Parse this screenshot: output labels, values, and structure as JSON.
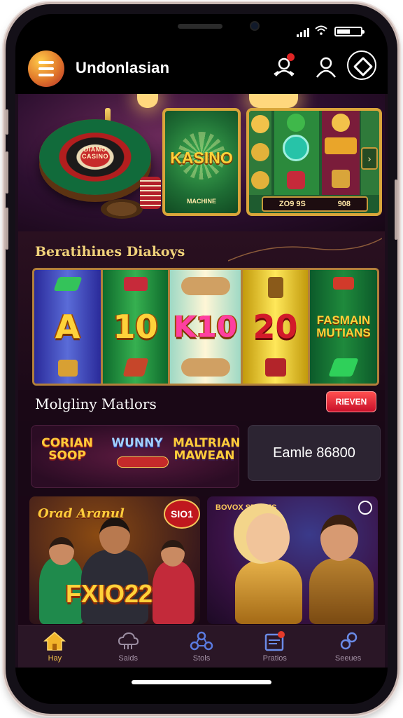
{
  "app": {
    "title": "Undonlasian"
  },
  "hero": {
    "roulette_label": "DIAMO CASINO",
    "kasino_title": "KASINO",
    "kasino_sub": "MACHINE",
    "slot_footer": [
      "ZO9 9S",
      "908"
    ]
  },
  "featured": {
    "title": "Beratihines Diakoys",
    "reels": [
      "A",
      "10",
      "K10",
      "20",
      "FASMAIN MUTIANS"
    ]
  },
  "matches": {
    "title": "Molgliny Matlors",
    "review_label": "RIEVEN"
  },
  "promos": {
    "logos": [
      "CORIAN SOOP",
      "WUNNY",
      "MALTRIAN MAWEAN"
    ],
    "earn_label": "Eamle 86800"
  },
  "cards": {
    "left": {
      "head": "Orad Aranul",
      "big": "FXIO22",
      "pill": "SIO1"
    },
    "right": {
      "tag": "BOVOX SRANJS"
    }
  },
  "nav": [
    {
      "label": "Hay",
      "icon": "home-icon",
      "active": true
    },
    {
      "label": "Saids",
      "icon": "cloud-icon",
      "active": false
    },
    {
      "label": "Stols",
      "icon": "network-icon",
      "active": false
    },
    {
      "label": "Pratios",
      "icon": "inbox-icon",
      "active": false
    },
    {
      "label": "Seeues",
      "icon": "settings-link-icon",
      "active": false
    }
  ],
  "colors": {
    "accent": "#f2c24a",
    "brand_red": "#e02525",
    "background": "#1c0d1c"
  }
}
